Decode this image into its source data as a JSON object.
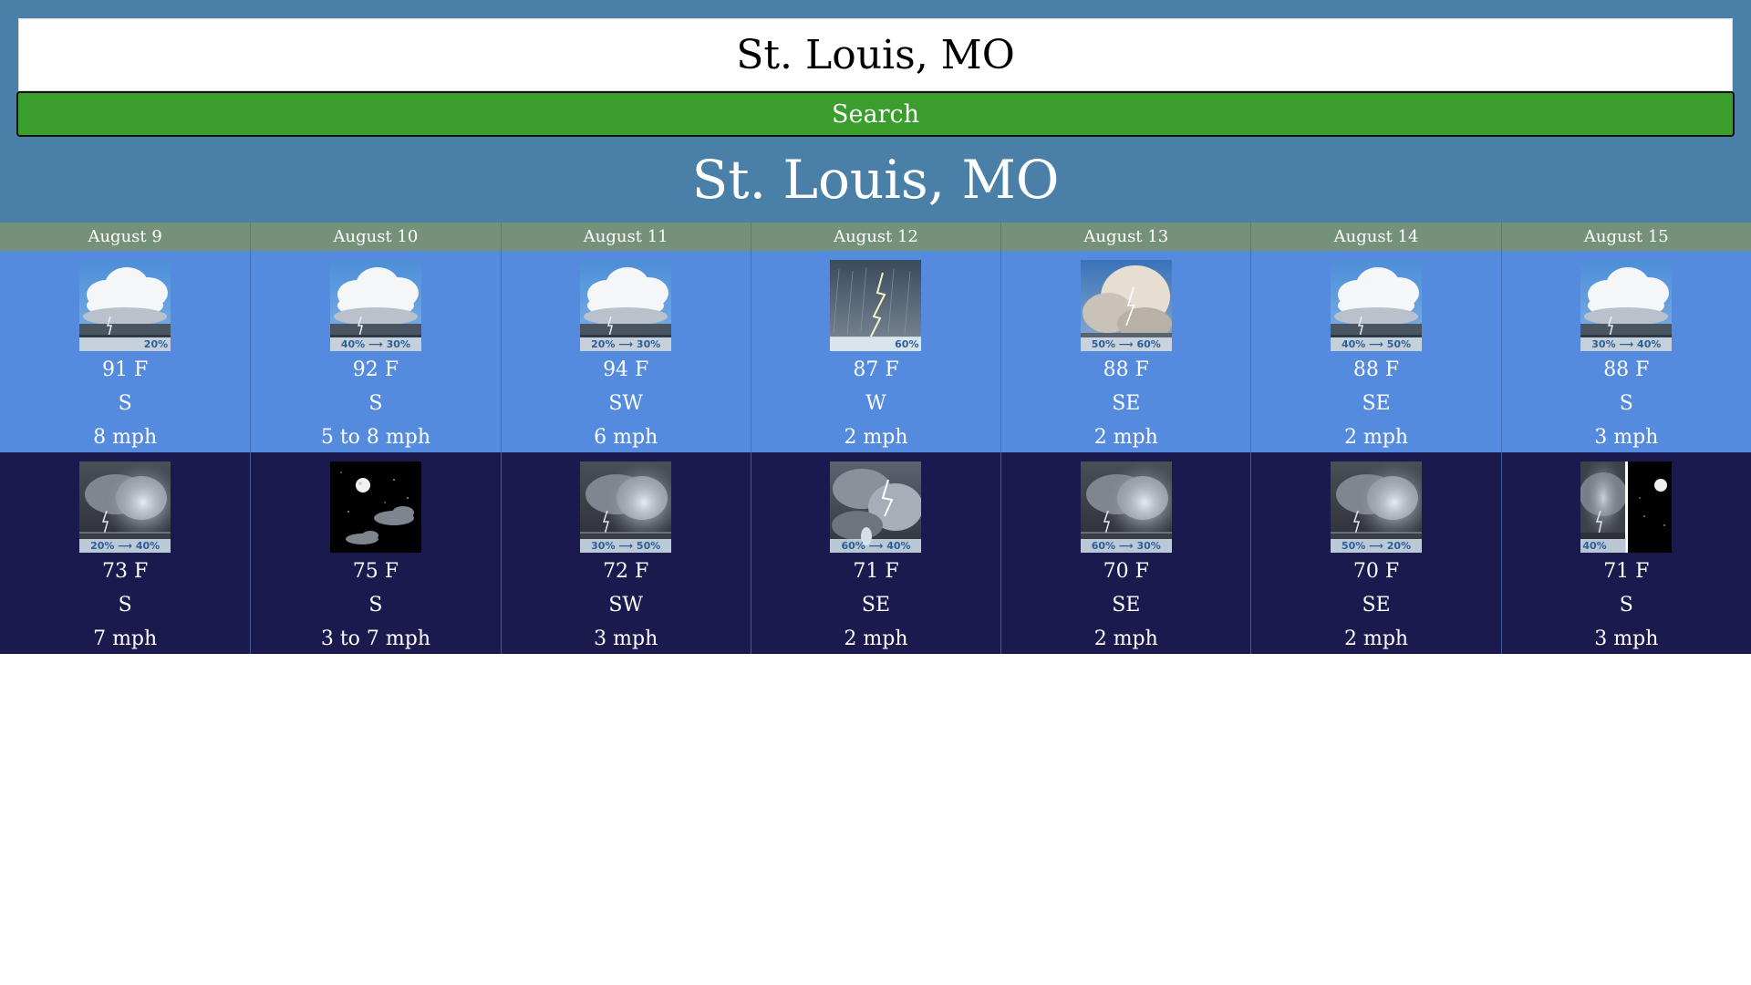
{
  "search": {
    "value": "St. Louis, MO",
    "button_label": "Search"
  },
  "title": "St. Louis, MO",
  "colors": {
    "header_bg": "#4a7fa8",
    "search_button": "#3a9e2c",
    "date_row": "#76917a",
    "day_row": "#558bdf",
    "night_row": "#1a1a4e"
  },
  "days": [
    {
      "date": "August 9",
      "day": {
        "icon": "thunderstorm-partly-cloudy-icon",
        "pop": "20%",
        "temp": "91 F",
        "wind_dir": "S",
        "wind_speed": "8 mph"
      },
      "night": {
        "icon": "thunderstorm-night-icon",
        "pop": "20% ⟶ 40%",
        "temp": "73 F",
        "wind_dir": "S",
        "wind_speed": "7 mph"
      }
    },
    {
      "date": "August 10",
      "day": {
        "icon": "thunderstorm-partly-cloudy-icon",
        "pop": "40% ⟶ 30%",
        "temp": "92 F",
        "wind_dir": "S",
        "wind_speed": "5 to 8 mph"
      },
      "night": {
        "icon": "moon-partly-cloudy-icon",
        "pop": "",
        "temp": "75 F",
        "wind_dir": "S",
        "wind_speed": "3 to 7 mph"
      }
    },
    {
      "date": "August 11",
      "day": {
        "icon": "thunderstorm-partly-cloudy-icon",
        "pop": "20% ⟶ 30%",
        "temp": "94 F",
        "wind_dir": "SW",
        "wind_speed": "6 mph"
      },
      "night": {
        "icon": "thunderstorm-night-icon",
        "pop": "30% ⟶ 50%",
        "temp": "72 F",
        "wind_dir": "SW",
        "wind_speed": "3 mph"
      }
    },
    {
      "date": "August 12",
      "day": {
        "icon": "lightning-rain-icon",
        "pop": "60%",
        "temp": "87 F",
        "wind_dir": "W",
        "wind_speed": "2 mph"
      },
      "night": {
        "icon": "lightning-storm-icon",
        "pop": "60% ⟶ 40%",
        "temp": "71 F",
        "wind_dir": "SE",
        "wind_speed": "2 mph"
      }
    },
    {
      "date": "August 13",
      "day": {
        "icon": "thunderstorm-cloud-icon",
        "pop": "50% ⟶ 60%",
        "temp": "88 F",
        "wind_dir": "SE",
        "wind_speed": "2 mph"
      },
      "night": {
        "icon": "thunderstorm-night-icon",
        "pop": "60% ⟶ 30%",
        "temp": "70 F",
        "wind_dir": "SE",
        "wind_speed": "2 mph"
      }
    },
    {
      "date": "August 14",
      "day": {
        "icon": "thunderstorm-partly-cloudy-icon",
        "pop": "40% ⟶ 50%",
        "temp": "88 F",
        "wind_dir": "SE",
        "wind_speed": "2 mph"
      },
      "night": {
        "icon": "thunderstorm-night-icon",
        "pop": "50% ⟶ 20%",
        "temp": "70 F",
        "wind_dir": "SE",
        "wind_speed": "2 mph"
      }
    },
    {
      "date": "August 15",
      "day": {
        "icon": "thunderstorm-partly-cloudy-icon",
        "pop": "30% ⟶ 40%",
        "temp": "88 F",
        "wind_dir": "S",
        "wind_speed": "3 mph"
      },
      "night": {
        "icon": "thunderstorm-then-clear-night-icon",
        "pop": "40%",
        "temp": "71 F",
        "wind_dir": "S",
        "wind_speed": "3 mph"
      }
    }
  ]
}
